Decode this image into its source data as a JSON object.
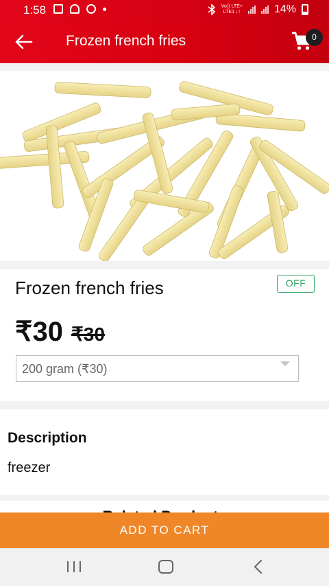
{
  "status_bar": {
    "time": "1:58",
    "network_label": "Vo)) LTE+\nLTE1 ↓↑",
    "battery_text": "14%"
  },
  "header": {
    "title": "Frozen french fries",
    "cart_count": "0"
  },
  "product": {
    "name": "Frozen french fries",
    "badge": "OFF",
    "price": "₹30",
    "old_price": "₹30",
    "variant_selected": "200 gram (₹30)"
  },
  "description": {
    "title": "Description",
    "text": "freezer"
  },
  "related": {
    "title": "Related Products"
  },
  "actions": {
    "add_to_cart": "ADD TO CART"
  },
  "icons": {
    "back": "arrow-left-icon",
    "cart": "cart-icon",
    "recent": "recent-apps-icon",
    "home": "home-icon",
    "nav_back": "nav-back-icon"
  },
  "colors": {
    "brand_red": "#d90012",
    "accent_orange": "#ef8628",
    "badge_green": "#2ca35e"
  }
}
